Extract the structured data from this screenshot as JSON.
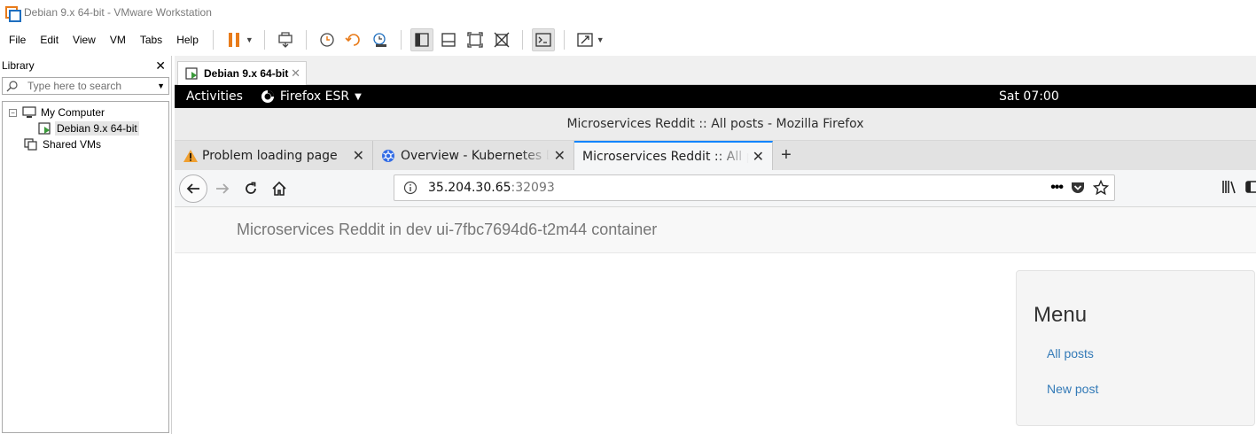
{
  "vmware": {
    "title": "Debian 9.x 64-bit - VMware Workstation",
    "menu": [
      "File",
      "Edit",
      "View",
      "VM",
      "Tabs",
      "Help"
    ],
    "library": {
      "title": "Library",
      "search_placeholder": "Type here to search",
      "tree": {
        "my_computer": "My Computer",
        "vm": "Debian 9.x 64-bit",
        "shared": "Shared VMs"
      }
    },
    "vm_tab": "Debian 9.x 64-bit"
  },
  "gnome": {
    "activities": "Activities",
    "app": "Firefox ESR",
    "clock": "Sat 07:00"
  },
  "firefox": {
    "window_title": "Microservices Reddit :: All posts - Mozilla Firefox",
    "tabs": [
      {
        "title": "Problem loading page",
        "icon": "warning-icon"
      },
      {
        "title": "Overview - Kubernetes Da",
        "icon": "kubernetes-icon"
      },
      {
        "title": "Microservices Reddit :: All po",
        "icon": "none"
      }
    ],
    "url": {
      "host": "35.204.30.65",
      "port": ":32093"
    }
  },
  "page": {
    "header": "Microservices Reddit in dev ui-7fbc7694d6-t2m44 container",
    "menu": {
      "title": "Menu",
      "links": [
        "All posts",
        "New post"
      ]
    }
  },
  "colors": {
    "link": "#337ab7",
    "active_tab_accent": "#0a84ff",
    "pause_orange": "#e87b1a"
  }
}
